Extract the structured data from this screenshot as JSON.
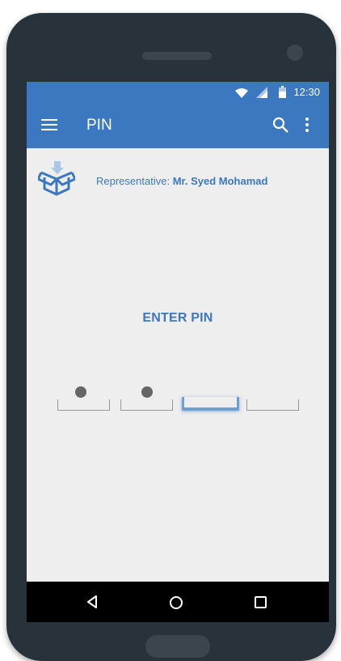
{
  "status_bar": {
    "time": "12:30"
  },
  "app_bar": {
    "title": "PIN",
    "menu_icon": "menu-icon",
    "search_icon": "search-icon",
    "more_icon": "more-vert-icon"
  },
  "representative": {
    "label": "Representative:",
    "name": "Mr. Syed Mohamad",
    "icon": "package-box-icon"
  },
  "pin": {
    "heading": "ENTER PIN",
    "digits_entered": 2,
    "total_digits": 4,
    "active_slot": 3
  },
  "nav_bar": {
    "back_icon": "back-triangle-icon",
    "home_icon": "home-circle-icon",
    "recents_icon": "recents-square-icon"
  },
  "colors": {
    "primary": "#3b78bf",
    "screen_bg": "#eeeeee",
    "phone_body": "#28323a"
  }
}
